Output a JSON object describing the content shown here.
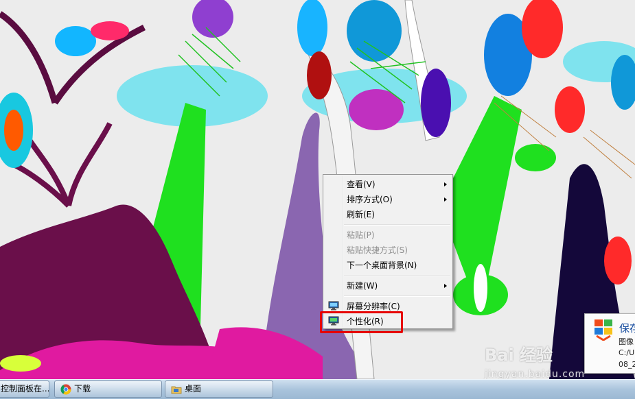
{
  "context_menu": {
    "items": [
      {
        "label": "查看(V)",
        "submenu": true,
        "enabled": true
      },
      {
        "label": "排序方式(O)",
        "submenu": true,
        "enabled": true
      },
      {
        "label": "刷新(E)",
        "submenu": false,
        "enabled": true
      },
      {
        "label": "粘贴(P)",
        "submenu": false,
        "enabled": false
      },
      {
        "label": "粘贴快捷方式(S)",
        "submenu": false,
        "enabled": false
      },
      {
        "label": "下一个桌面背景(N)",
        "submenu": false,
        "enabled": true
      },
      {
        "label": "新建(W)",
        "submenu": true,
        "enabled": true
      },
      {
        "label": "屏幕分辨率(C)",
        "submenu": false,
        "enabled": true,
        "icon": "display-icon"
      },
      {
        "label": "个性化(R)",
        "submenu": false,
        "enabled": true,
        "icon": "personalize-icon"
      }
    ],
    "highlighted_item": "个性化(R)",
    "highlight_color": "#e60000"
  },
  "notification": {
    "title": "保存",
    "line1": "图像",
    "line2": "C:/U",
    "line3": "08_2"
  },
  "watermark": {
    "main": "Bai 经验",
    "sub": "jingyan.baidu.com"
  },
  "taskbar": {
    "buttons": [
      {
        "label": "控制面板在...",
        "icon": "control-panel-icon"
      },
      {
        "label": "下载",
        "icon": "chrome-icon"
      },
      {
        "label": "桌面",
        "icon": "folder-icon"
      }
    ]
  },
  "colors": {
    "wallpaper_bg": "#e9e9e9",
    "menu_bg": "#f1f1f1",
    "taskbar": "#aac4dc"
  }
}
